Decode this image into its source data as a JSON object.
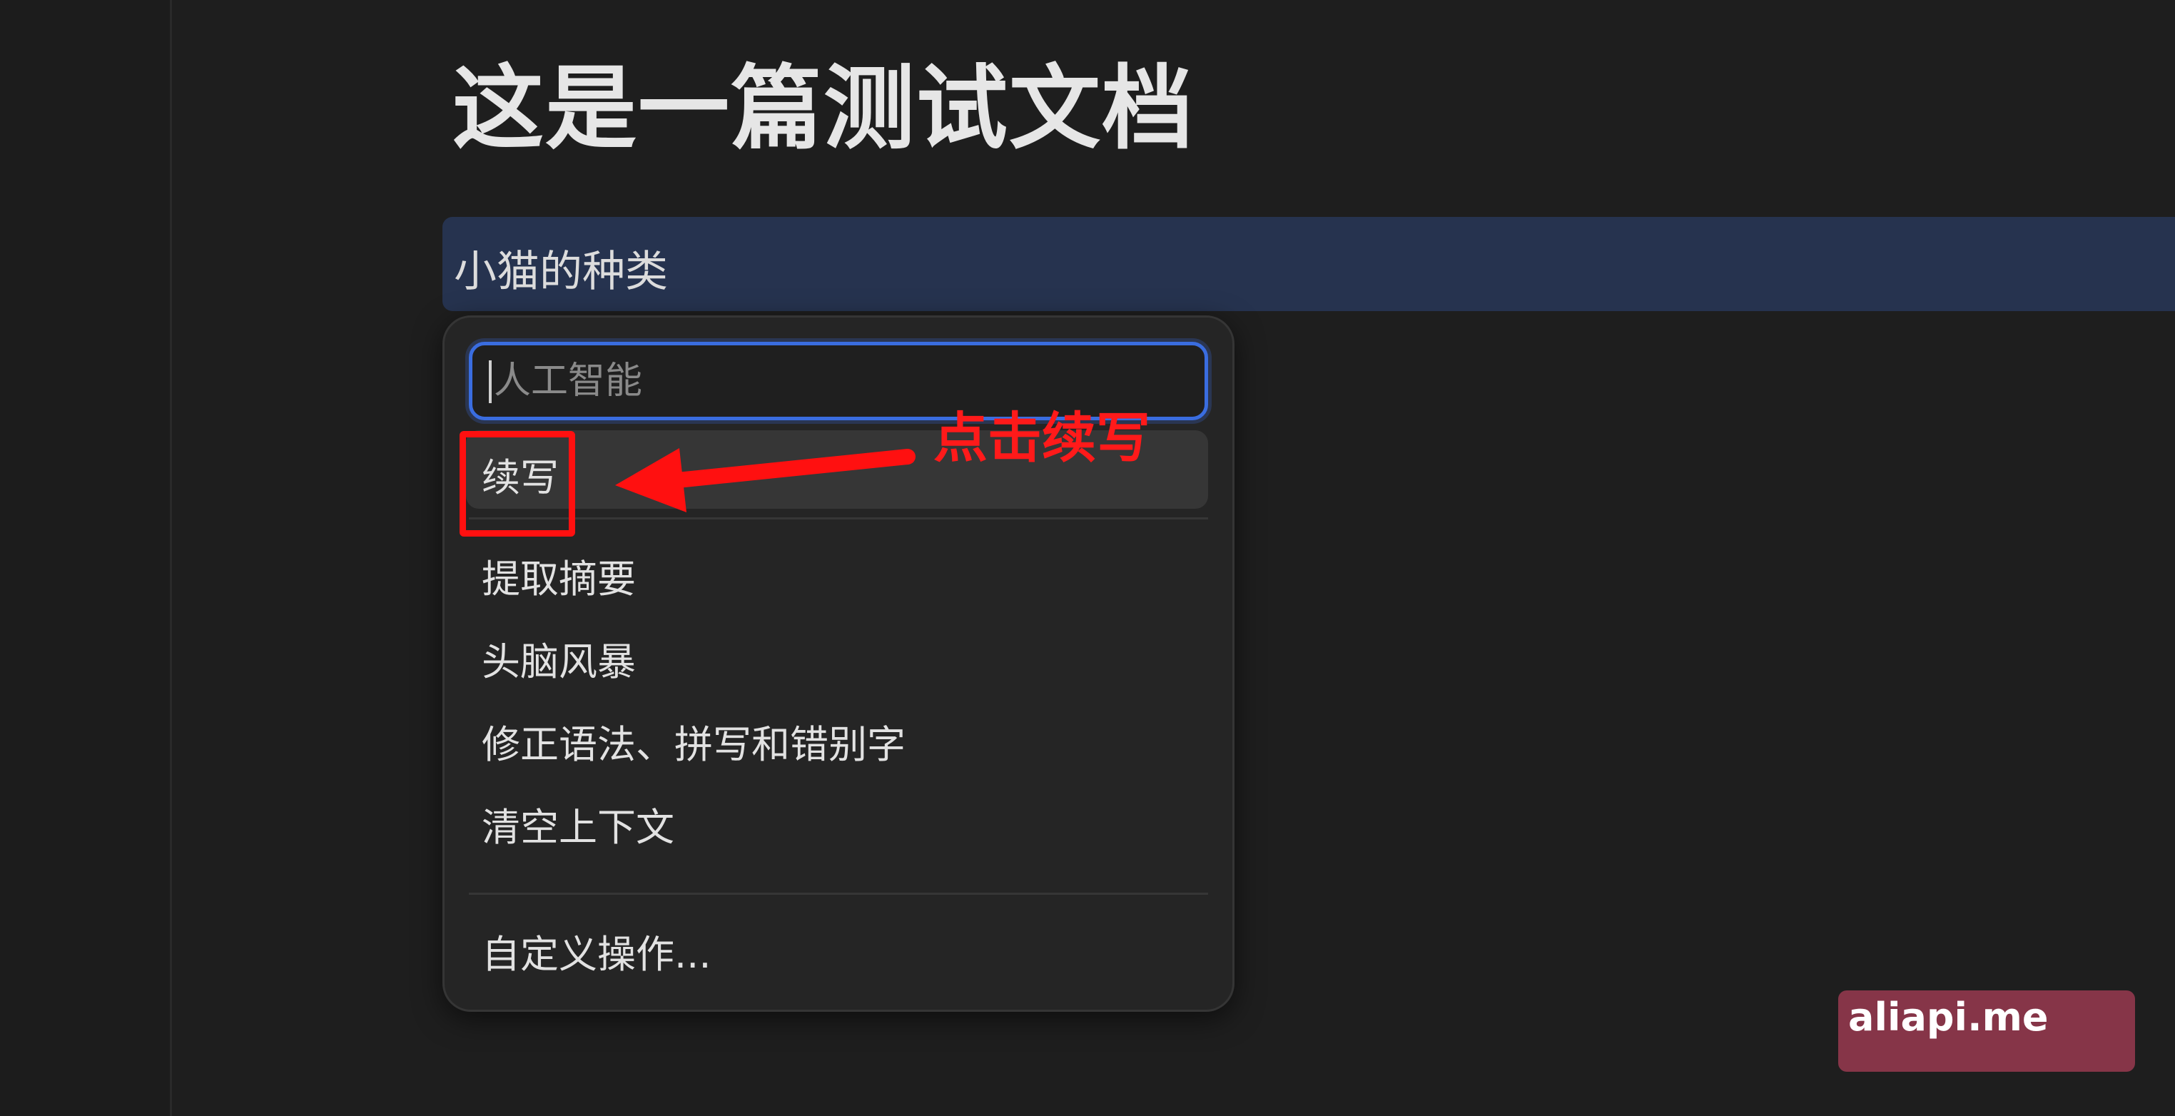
{
  "document": {
    "title": "这是一篇测试文档",
    "selected_block_text": "小猫的种类"
  },
  "ai_menu": {
    "input_placeholder": "人工智能",
    "items": [
      {
        "label": "续写",
        "active": true
      },
      {
        "label": "提取摘要",
        "active": false
      },
      {
        "label": "头脑风暴",
        "active": false
      },
      {
        "label": "修正语法、拼写和错别字",
        "active": false
      },
      {
        "label": "清空上下文",
        "active": false
      }
    ],
    "custom_action_label": "自定义操作..."
  },
  "annotation": {
    "text": "点击续写",
    "color": "#ff1a1a"
  },
  "watermark": {
    "text": "aliapi.me",
    "background": "#863548"
  },
  "colors": {
    "background": "#1e1e1e",
    "selection": "#26334f",
    "focus_ring": "#3a6de0"
  }
}
